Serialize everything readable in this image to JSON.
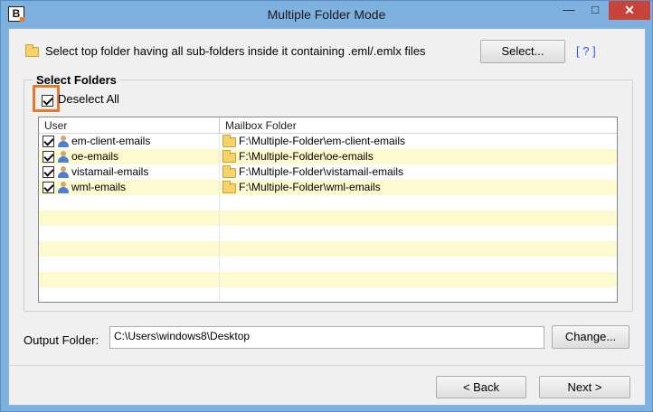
{
  "window": {
    "title": "Multiple Folder Mode",
    "app_icon_letter": "B",
    "minimize_glyph": "—",
    "maximize_glyph": "□",
    "close_glyph": "✕"
  },
  "top": {
    "instruction": "Select top folder having all sub-folders inside it containing .eml/.emlx files",
    "select_button": "Select...",
    "help_link": "[ ? ]"
  },
  "folders": {
    "group_title": "Select Folders",
    "deselect_all_label": "Deselect All",
    "deselect_all_checked": true,
    "columns": [
      "User",
      "Mailbox Folder"
    ],
    "rows": [
      {
        "user": "em-client-emails",
        "folder": "F:\\Multiple-Folder\\em-client-emails",
        "checked": true
      },
      {
        "user": "oe-emails",
        "folder": "F:\\Multiple-Folder\\oe-emails",
        "checked": true
      },
      {
        "user": "vistamail-emails",
        "folder": "F:\\Multiple-Folder\\vistamail-emails",
        "checked": true
      },
      {
        "user": "wml-emails",
        "folder": "F:\\Multiple-Folder\\wml-emails",
        "checked": true
      }
    ]
  },
  "output": {
    "label": "Output Folder:",
    "value": "C:\\Users\\windows8\\Desktop",
    "change_button": "Change..."
  },
  "nav": {
    "back_button": "< Back",
    "next_button": "Next >"
  },
  "colors": {
    "highlight": "#e07a2e",
    "row_alt": "#fdfad0",
    "titlebar": "#7eb0e0",
    "close": "#c7443a",
    "link": "#2b5fd9"
  },
  "icons": {
    "app": "app-logo-icon",
    "folder": "folder-icon",
    "user": "user-icon",
    "checkbox": "checkbox-checked-icon"
  }
}
